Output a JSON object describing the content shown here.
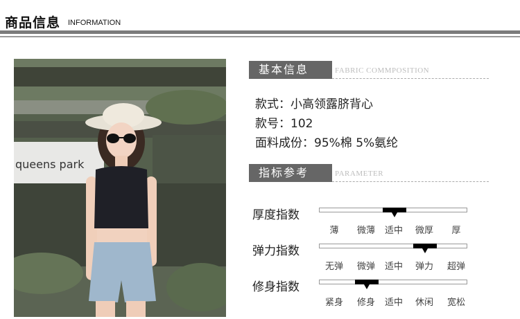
{
  "header": {
    "title": "商品信息",
    "subtitle": "INFORMATION"
  },
  "photo": {
    "sign_text": "queens park"
  },
  "basic": {
    "tab_label": "基本信息",
    "en_label": "FABRIC COMMPOSITION",
    "style": "款式：小高领露脐背心",
    "item_no": "款号：102",
    "fabric": "面料成份：95%棉 5%氨纶"
  },
  "params": {
    "tab_label": "指标参考",
    "en_label": "PARAMETER",
    "rows": [
      {
        "label": "厚度指数",
        "options": [
          "薄",
          "微薄",
          "适中",
          "微厚",
          "厚"
        ],
        "selected_index": 2
      },
      {
        "label": "弹力指数",
        "options": [
          "无弹",
          "微弹",
          "适中",
          "弹力",
          "超弹"
        ],
        "selected_index": 3
      },
      {
        "label": "修身指数",
        "options": [
          "紧身",
          "修身",
          "适中",
          "休闲",
          "宽松"
        ],
        "selected_index": 1
      }
    ]
  }
}
